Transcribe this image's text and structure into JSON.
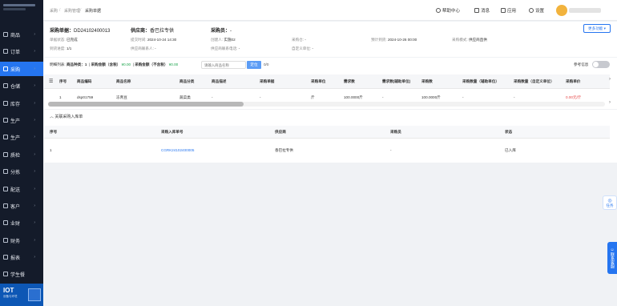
{
  "sidebar": {
    "items": [
      {
        "label": "商品",
        "has_sub": true
      },
      {
        "label": "订单",
        "has_sub": true
      },
      {
        "label": "采购",
        "has_sub": true,
        "active": true
      },
      {
        "label": "仓储",
        "has_sub": true
      },
      {
        "label": "库存",
        "has_sub": true
      },
      {
        "label": "生产",
        "has_sub": true
      },
      {
        "label": "生产",
        "has_sub": true
      },
      {
        "label": "质检",
        "has_sub": true
      },
      {
        "label": "分拣",
        "has_sub": true
      },
      {
        "label": "配送",
        "has_sub": true
      },
      {
        "label": "客户",
        "has_sub": true
      },
      {
        "label": "业财",
        "has_sub": true
      },
      {
        "label": "财务",
        "has_sub": true
      },
      {
        "label": "报表",
        "has_sub": true
      },
      {
        "label": "学生餐",
        "has_sub": false
      }
    ],
    "iot": {
      "title": "IOT",
      "subtitle": "设备与环境"
    }
  },
  "header": {
    "breadcrumb": [
      "采购",
      "采购管理",
      "采购单据"
    ],
    "help": "帮助中心",
    "messages": "消息",
    "apps": "应用",
    "settings": "设置"
  },
  "order": {
    "no_label": "采购单据：",
    "no": "DD24102400013",
    "supplier_label": "供应商：",
    "supplier": "香巴拉专供",
    "buyer_label": "采购员：",
    "buyer": "-",
    "more_button": "更多功能",
    "fields": [
      {
        "label": "单据状态:",
        "value": "已完成"
      },
      {
        "label": "提交时间:",
        "value": "2024-10-24 14:30"
      },
      {
        "label": "创建人:",
        "value": "实施02"
      },
      {
        "label": "采购仓:",
        "value": "-"
      },
      {
        "label": "预计到货:",
        "value": "2024-10-26 00:00"
      },
      {
        "label": "采购模式:",
        "value": "供应商直供"
      },
      {
        "label": "到货进度:",
        "value": "1/1"
      },
      {
        "label": "供应商联系人:",
        "value": "-"
      },
      {
        "label": "供应商联系电话:",
        "value": "-"
      },
      {
        "label": "自定义单位:",
        "value": "-"
      }
    ]
  },
  "summary": {
    "label": "明细列表:",
    "kinds_label": "商品种类：",
    "kinds": "1",
    "amount_tax_label": "采购金额（含税）",
    "amount_tax": "¥0.00",
    "amount_notax_label": "采购金额（不含税）",
    "amount_notax": "¥0.00",
    "search_placeholder": "请输入商品名称",
    "locate_button": "定位",
    "count": "0/0",
    "ref_label": "参考信息"
  },
  "detail_table": {
    "headers": [
      "序号",
      "商品编码",
      "商品名称",
      "商品分类",
      "商品描述",
      "采购单据",
      "采购单位",
      "需求数",
      "需求数(辅助单位)",
      "采购数",
      "采购数量（辅助单位）",
      "采购数量（自定义单位）",
      "采购单价"
    ],
    "rows": [
      [
        "1",
        "dsp01759",
        "冻青豆",
        "蔬菜类",
        "-",
        "-",
        "斤",
        "100.0000斤",
        "-",
        "100.0000斤",
        "-",
        "-",
        "0.00元/斤"
      ]
    ]
  },
  "related": {
    "title": "关联采购入库单",
    "headers": [
      "序号",
      "采购入库单号",
      "供应商",
      "采购员",
      "状态"
    ],
    "rows": [
      [
        "1",
        "CGRK24102400005",
        "香巴拉专供",
        "-",
        "已入库"
      ]
    ]
  },
  "float": {
    "tasks": "任务",
    "service": "联系客服"
  }
}
